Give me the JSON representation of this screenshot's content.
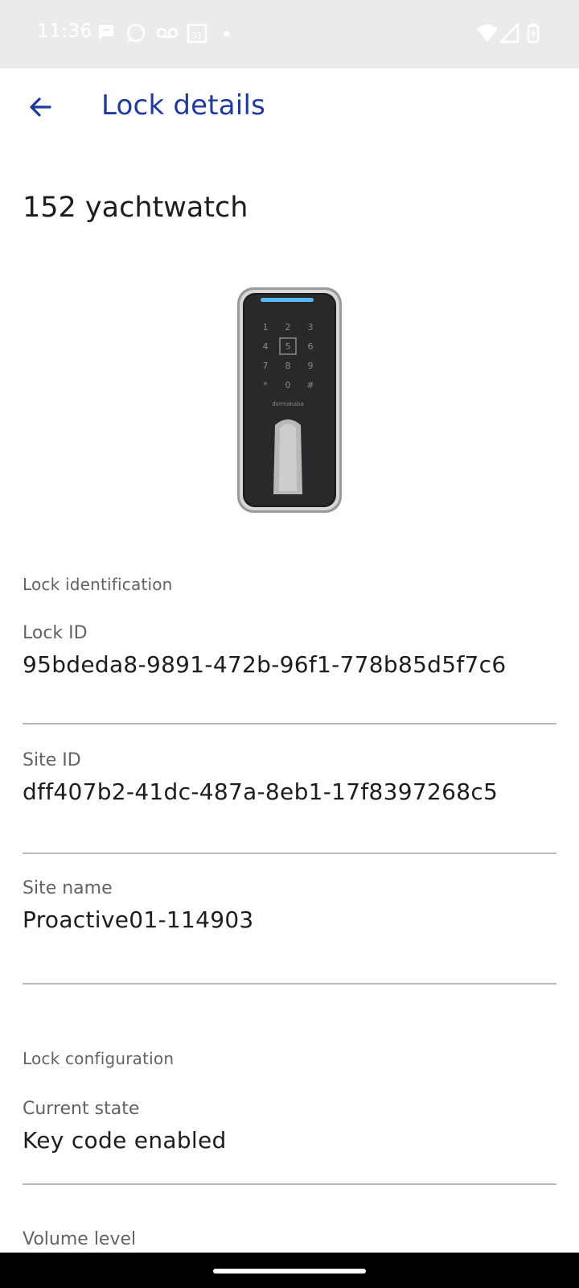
{
  "status_bar": {
    "time": "11:36",
    "icons": [
      "message-icon",
      "whatsapp-icon",
      "voicemail-icon",
      "calendar-icon",
      "dot-icon",
      "wifi-icon",
      "signal-icon",
      "battery-icon"
    ],
    "calendar_day": "31"
  },
  "app_bar": {
    "back_icon": "arrow-left-icon",
    "title": "Lock details"
  },
  "lock": {
    "name": "152 yachtwatch",
    "keypad_keys": [
      "1",
      "2",
      "3",
      "4",
      "5",
      "6",
      "7",
      "8",
      "9",
      "*",
      "0",
      "#"
    ],
    "brand": "dormakaba"
  },
  "sections": {
    "identification": {
      "header": "Lock identification",
      "fields": [
        {
          "label": "Lock ID",
          "value": "95bdeda8-9891-472b-96f1-778b85d5f7c6"
        },
        {
          "label": "Site ID",
          "value": "dff407b2-41dc-487a-8eb1-17f8397268c5"
        },
        {
          "label": "Site name",
          "value": "Proactive01-114903"
        }
      ]
    },
    "configuration": {
      "header": "Lock configuration",
      "fields": [
        {
          "label": "Current state",
          "value": "Key code enabled"
        },
        {
          "label": "Volume level",
          "value": ""
        }
      ]
    }
  },
  "colors": {
    "accent": "#1f3a9c",
    "status_bar_bg": "#ebebeb",
    "divider": "#b9b9b9",
    "secondary_text": "#5f6366"
  }
}
